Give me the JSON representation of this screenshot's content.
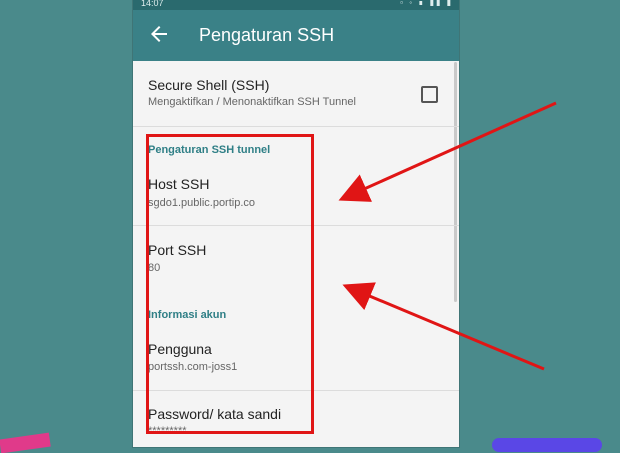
{
  "status": {
    "time": "14:07",
    "icons": "▫ ◦ ∎ ▮▮ ▮"
  },
  "appbar": {
    "title": "Pengaturan SSH"
  },
  "ssh": {
    "title": "Secure Shell (SSH)",
    "subtitle": "Mengaktifkan / Menonaktifkan SSH Tunnel",
    "checked": false
  },
  "tunnel": {
    "category": "Pengaturan SSH tunnel",
    "host_label": "Host SSH",
    "host_value": "sgdo1.public.portip.co",
    "port_label": "Port SSH",
    "port_value": "80"
  },
  "account": {
    "category": "Informasi akun",
    "user_label": "Pengguna",
    "user_value": "portssh.com-joss1",
    "password_label": "Password/ kata sandi",
    "password_value": "*********"
  },
  "colors": {
    "appbar": "#3a8187",
    "accent": "#2f7f86",
    "annotation": "#e01515",
    "background": "#4a8a8b"
  }
}
